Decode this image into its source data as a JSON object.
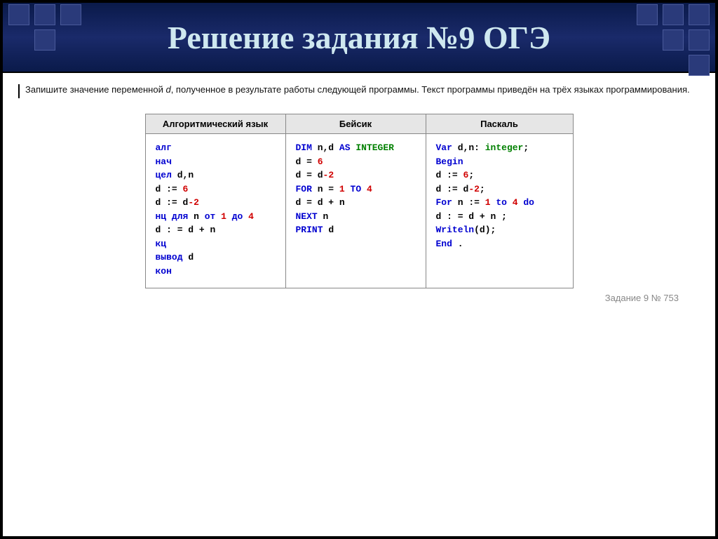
{
  "header": {
    "title": "Решение задания №9 ОГЭ"
  },
  "prompt": {
    "before_var": "Запишите значение переменной ",
    "var": "d",
    "after_var": ", полученное в результате работы следующей программы. Текст программы приведён на трёх языках программирования."
  },
  "table": {
    "headers": [
      "Алгоритмический язык",
      "Бейсик",
      "Паскаль"
    ],
    "alg": {
      "l1": "алг",
      "l2": " нач",
      "l3_a": " цел ",
      "l3_b": "d,n",
      "l4_a": " d := ",
      "l4_b": "6",
      "l5_a": " d := d",
      "l5_b": "-2",
      "l6_a": " нц для ",
      "l6_b": "n",
      "l6_c": " от ",
      "l6_d": "1",
      "l6_e": " до ",
      "l6_f": "4",
      "l7": "d : = d + n",
      "l8": " кц",
      "l9_a": " вывод ",
      "l9_b": "d",
      "l10": " кон"
    },
    "basic": {
      "l1_a": "DIM",
      "l1_b": " n,d ",
      "l1_c": "AS",
      "l1_d": " ",
      "l1_e": "INTEGER",
      "l2_a": " d = ",
      "l2_b": "6",
      "l3_a": " d = d",
      "l3_b": "-2",
      "l4_a": "FOR",
      "l4_b": " n = ",
      "l4_c": "1",
      "l4_d": " TO ",
      "l4_e": "4",
      "l5": " d = d + n",
      "l6_a": " NEXT",
      "l6_b": " n",
      "l7_a": " PRINT",
      "l7_b": " d"
    },
    "pascal": {
      "l1_a": "Var ",
      "l1_b": "d,n: ",
      "l1_c": "integer",
      "l1_d": ";",
      "l2": " Begin",
      "l3_a": " d := ",
      "l3_b": "6",
      "l3_c": ";",
      "l4_a": " d := d",
      "l4_b": "-2",
      "l4_c": ";",
      "l5_a": " For ",
      "l5_b": "n := ",
      "l5_c": "1",
      "l5_d": " to ",
      "l5_e": "4",
      "l5_f": " do",
      "l6": " d : = d + n ;",
      "l7_a": " Writeln",
      "l7_b": "(d);",
      "l8_a": " End",
      "l8_b": " ."
    }
  },
  "footer": {
    "note": "Задание 9 № 753"
  }
}
